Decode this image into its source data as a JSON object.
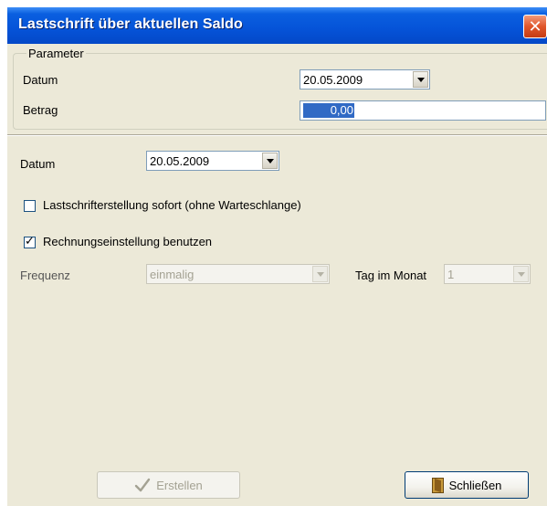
{
  "window": {
    "title": "Lastschrift über aktuellen Saldo",
    "close_glyph": "✕"
  },
  "parameter_group": {
    "legend": "Parameter",
    "date_label": "Datum",
    "date_value": "20.05.2009",
    "amount_label": "Betrag",
    "amount_value": "0,00"
  },
  "main": {
    "date_label": "Datum",
    "date_value": "20.05.2009",
    "immediate_checkbox_label": "Lastschrifterstellung sofort (ohne Warteschlange)",
    "immediate_checked": false,
    "invoice_settings_label": "Rechnungseinstellung benutzen",
    "invoice_settings_checked": true,
    "frequency_label": "Frequenz",
    "frequency_value": "einmalig",
    "day_label": "Tag im Monat",
    "day_value": "1"
  },
  "buttons": {
    "create_label": "Erstellen",
    "close_label": "Schließen"
  },
  "icons": {
    "create": "checkmark-icon",
    "close": "door-icon"
  }
}
